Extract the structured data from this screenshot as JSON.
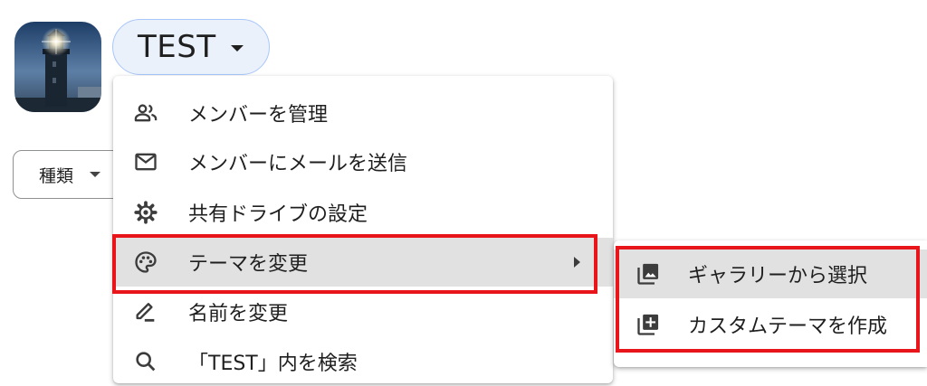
{
  "drive": {
    "name": "TEST"
  },
  "filters": {
    "type_label": "種類"
  },
  "menu": {
    "items": [
      {
        "label": "メンバーを管理",
        "icon": "manage-members-icon"
      },
      {
        "label": "メンバーにメールを送信",
        "icon": "mail-icon"
      },
      {
        "label": "共有ドライブの設定",
        "icon": "gear-icon"
      },
      {
        "label": "テーマを変更",
        "icon": "palette-icon"
      },
      {
        "label": "名前を変更",
        "icon": "pencil-icon"
      },
      {
        "label": "「TEST」内を検索",
        "icon": "search-icon"
      }
    ]
  },
  "submenu": {
    "items": [
      {
        "label": "ギャラリーから選択",
        "icon": "gallery-icon"
      },
      {
        "label": "カスタムテーマを作成",
        "icon": "add-box-icon"
      }
    ]
  },
  "colors": {
    "highlight_border": "#e8151a",
    "active_row": "#e1e1e1",
    "chip_bg": "#eaf1fb",
    "chip_border": "#a8c7fa"
  }
}
